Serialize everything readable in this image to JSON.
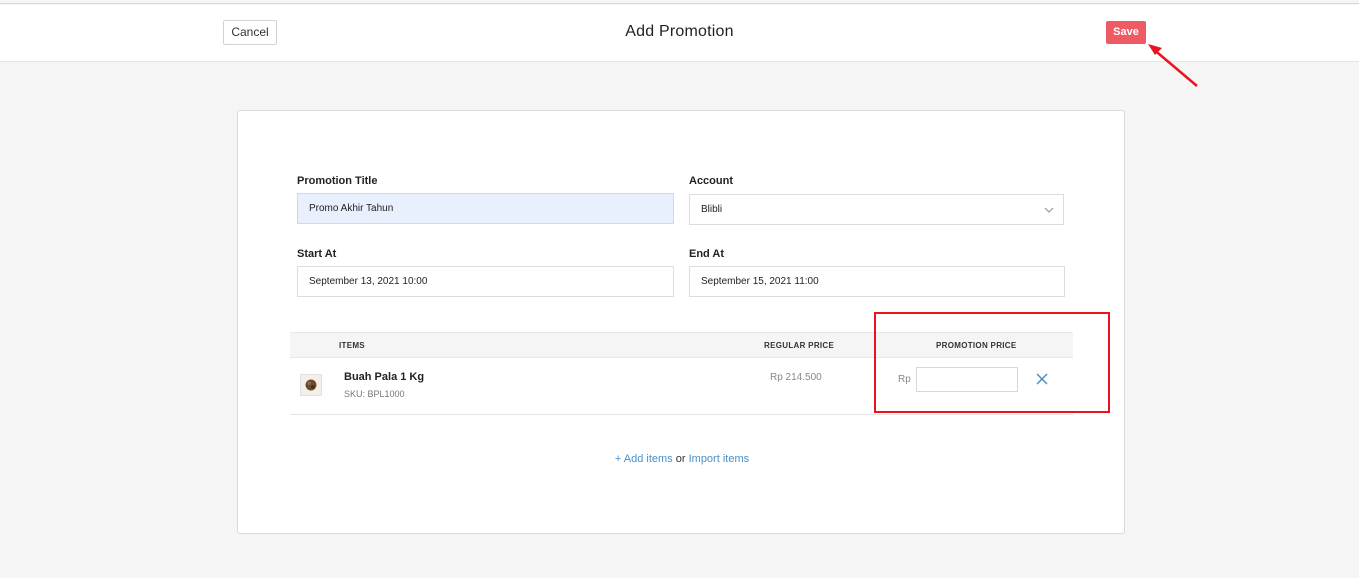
{
  "header": {
    "cancel_label": "Cancel",
    "title": "Add Promotion",
    "save_label": "Save"
  },
  "form": {
    "promotion_title": {
      "label": "Promotion Title",
      "value": "Promo Akhir Tahun"
    },
    "account": {
      "label": "Account",
      "value": "Blibli"
    },
    "start_at": {
      "label": "Start At",
      "value": "September 13, 2021 10:00"
    },
    "end_at": {
      "label": "End At",
      "value": "September 15, 2021 11:00"
    }
  },
  "table": {
    "columns": [
      "ITEMS",
      "REGULAR PRICE",
      "PROMOTION PRICE"
    ],
    "rows": [
      {
        "name": "Buah Pala 1 Kg",
        "sku": "SKU: BPL1000",
        "regular_price": "Rp 214.500",
        "currency": "Rp",
        "promotion_price": ""
      }
    ]
  },
  "actions": {
    "add_items": "+ Add items",
    "or": "or",
    "import_items": "Import items"
  },
  "colors": {
    "save": "#ef5b64",
    "link": "#4a90c8",
    "annotation": "#e8141f"
  },
  "icons": {
    "account_dropdown": "chevron-down-icon",
    "remove_item": "close-icon",
    "thumbnail": "product-image"
  }
}
